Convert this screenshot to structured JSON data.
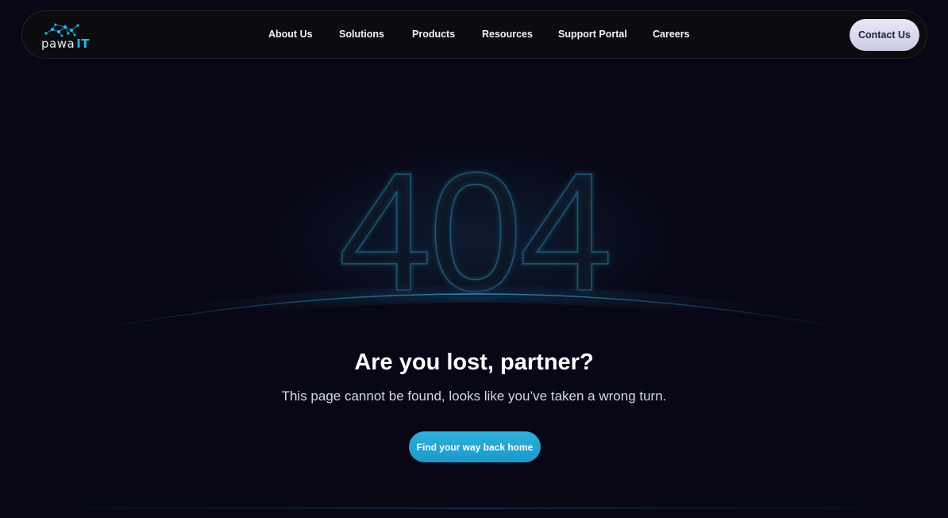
{
  "brand": {
    "logo_text": "pawa",
    "logo_suffix": "IT",
    "accent": "#29b6e8"
  },
  "nav": {
    "items": [
      {
        "label": "About Us"
      },
      {
        "label": "Solutions"
      },
      {
        "label": "Products"
      },
      {
        "label": "Resources"
      },
      {
        "label": "Support Portal"
      },
      {
        "label": "Careers"
      }
    ],
    "contact_label": "Contact Us"
  },
  "error": {
    "code": "404",
    "title": "Are you lost, partner?",
    "message": "This page cannot be found, looks like you’ve taken a wrong turn.",
    "cta_label": "Find your way back home"
  },
  "colors": {
    "background": "#080716",
    "button": "#22a4d3",
    "outline": "#1d4f6c"
  }
}
